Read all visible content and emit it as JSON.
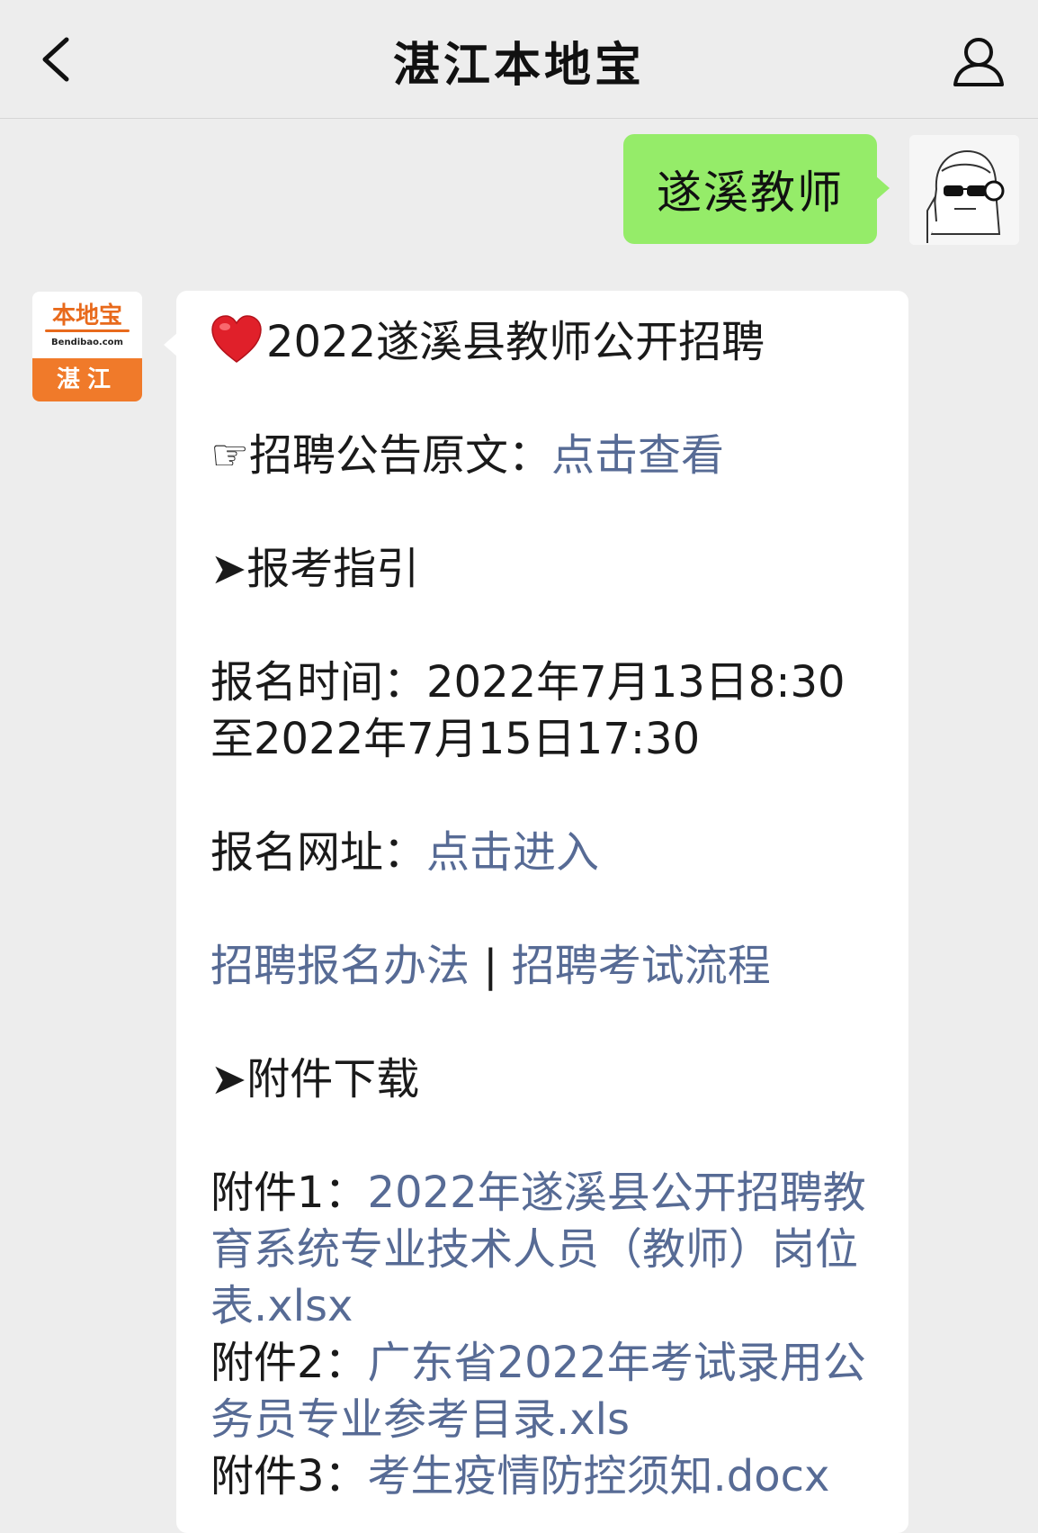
{
  "header": {
    "title": "湛江本地宝"
  },
  "user_message": {
    "text": "遂溪教师"
  },
  "bot_avatar": {
    "brand": "本地宝",
    "domain": "Bendibao.com",
    "city": "湛江"
  },
  "bot_message": {
    "headline": "2022遂溪县教师公开招聘",
    "notice_prefix": "☞招聘公告原文：",
    "notice_link": "点击查看",
    "guide_heading": "➤报考指引",
    "reg_time_label": "报名时间：",
    "reg_time_value_1": "2022年7月13日8:30",
    "reg_time_value_2": "至2022年7月15日17:30",
    "reg_url_label": "报名网址：",
    "reg_url_link": "点击进入",
    "method_link": "招聘报名办法",
    "separator": " | ",
    "process_link": "招聘考试流程",
    "attach_heading": "➤附件下载",
    "attachments": [
      {
        "label": "附件1：",
        "link": "2022年遂溪县公开招聘教育系统专业技术人员（教师）岗位表.xlsx"
      },
      {
        "label": "附件2：",
        "link": "广东省2022年考试录用公务员专业参考目录.xls"
      },
      {
        "label": "附件3：",
        "link": "考生疫情防控须知.docx"
      }
    ]
  },
  "colors": {
    "background": "#ededed",
    "user_bubble": "#95ec69",
    "link": "#576b95",
    "brand_orange": "#f07a2a"
  }
}
